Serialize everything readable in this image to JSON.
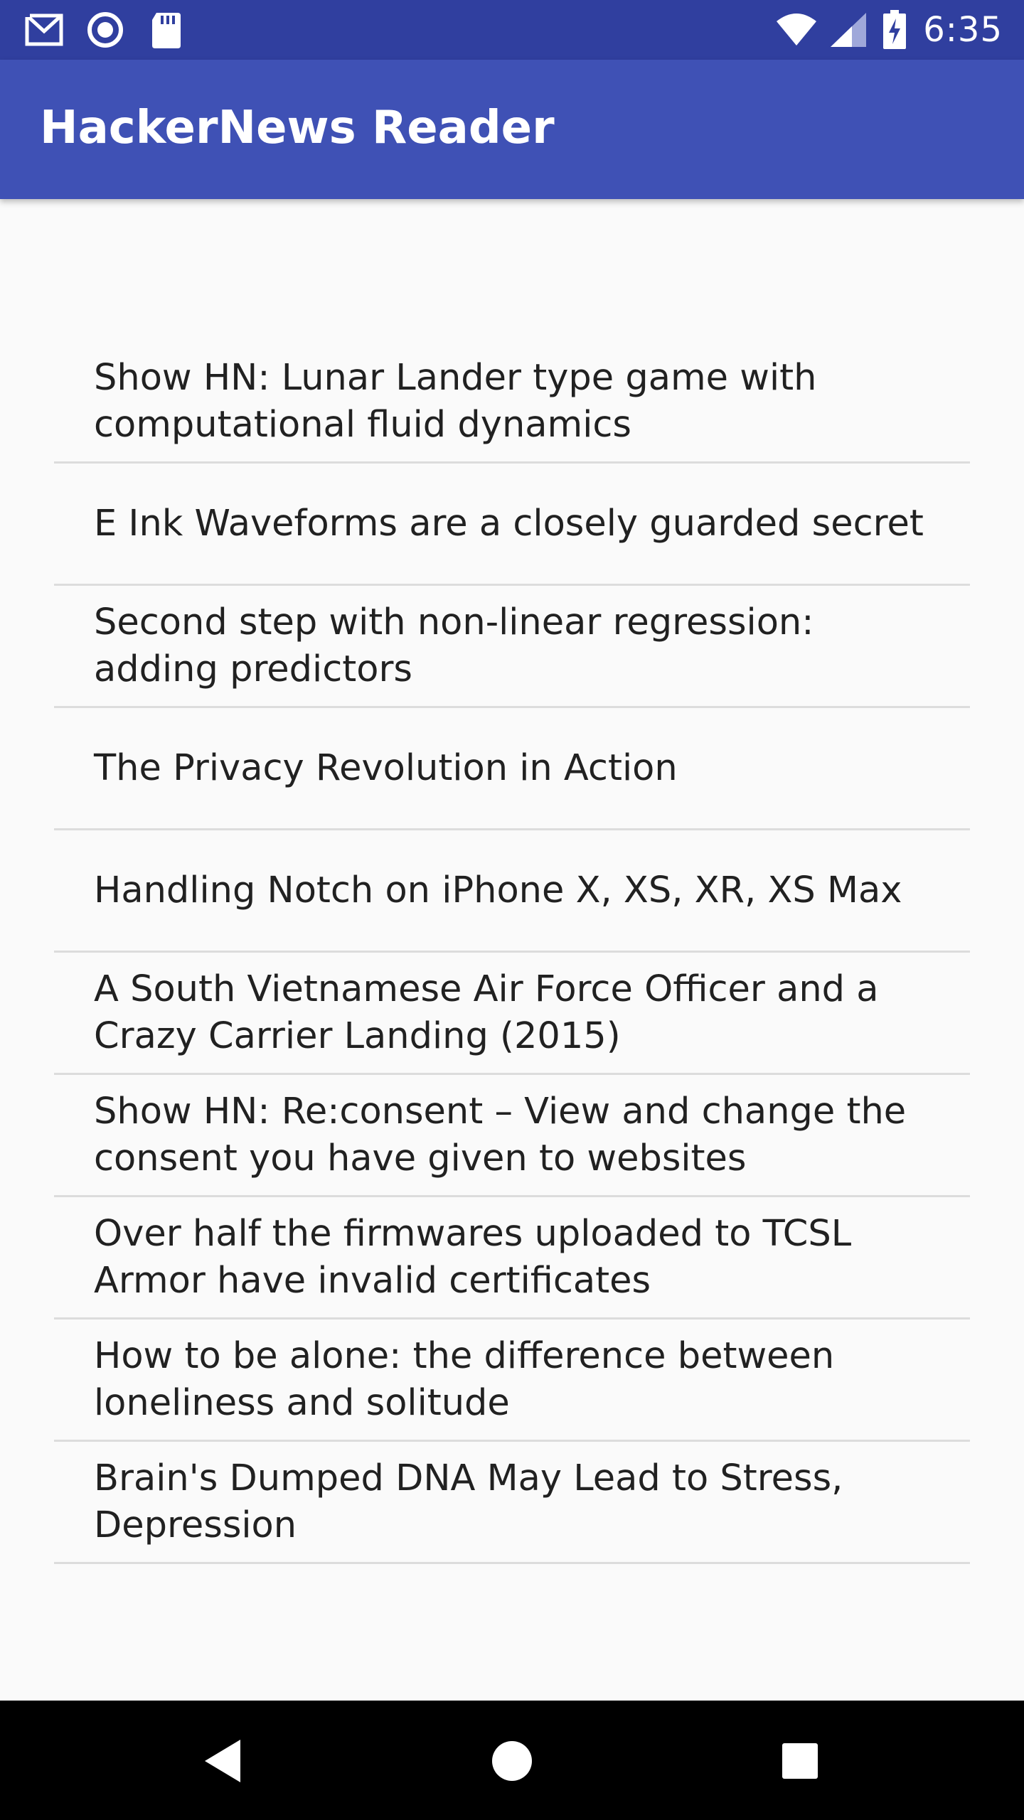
{
  "status_bar": {
    "time": "6:35",
    "icons_left": [
      "gmail-icon",
      "sync-icon",
      "sd-card-icon"
    ],
    "icons_right": [
      "wifi-icon",
      "cell-signal-icon",
      "battery-charging-icon"
    ],
    "background": "#303f9f"
  },
  "app_bar": {
    "title": "HackerNews Reader",
    "background": "#3f51b5"
  },
  "stories": [
    {
      "title": "Show HN: Lunar Lander type game with computational fluid dynamics"
    },
    {
      "title": "E Ink Waveforms are a closely guarded secret"
    },
    {
      "title": "Second step with non-linear regression: adding predictors"
    },
    {
      "title": "The Privacy Revolution in Action"
    },
    {
      "title": "Handling Notch on iPhone X, XS, XR, XS Max"
    },
    {
      "title": "A South Vietnamese Air Force Officer and a Crazy Carrier Landing (2015)"
    },
    {
      "title": "Show HN: Re:consent – View and change the consent you have given to websites"
    },
    {
      "title": "Over half the firmwares uploaded to TCSL Armor have invalid certificates"
    },
    {
      "title": "How to be alone: the difference between loneliness and solitude"
    },
    {
      "title": "Brain's Dumped DNA May Lead to Stress, Depression"
    }
  ],
  "nav_bar": {
    "buttons": [
      "back-icon",
      "home-icon",
      "recents-icon"
    ]
  }
}
